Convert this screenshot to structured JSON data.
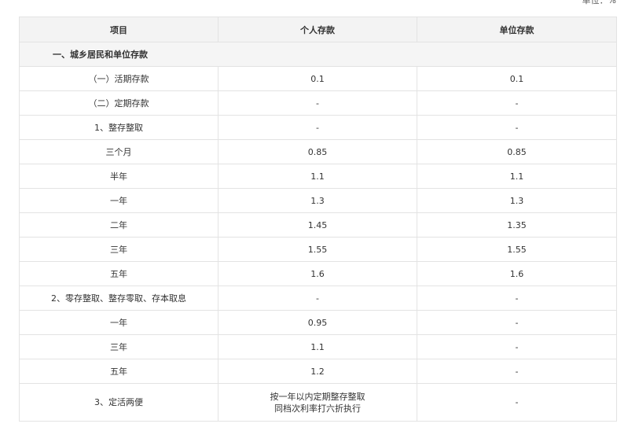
{
  "unit_note": "单位：%",
  "headers": [
    "项目",
    "个人存款",
    "单位存款"
  ],
  "section_title": "一、城乡居民和单位存款",
  "rows": [
    {
      "item": "（一）活期存款",
      "personal": "0.1",
      "unit": "0.1"
    },
    {
      "item": "（二）定期存款",
      "personal": "-",
      "unit": "-"
    },
    {
      "item": "1、整存整取",
      "personal": "-",
      "unit": "-"
    },
    {
      "item": "三个月",
      "personal": "0.85",
      "unit": "0.85"
    },
    {
      "item": "半年",
      "personal": "1.1",
      "unit": "1.1"
    },
    {
      "item": "一年",
      "personal": "1.3",
      "unit": "1.3"
    },
    {
      "item": "二年",
      "personal": "1.45",
      "unit": "1.35"
    },
    {
      "item": "三年",
      "personal": "1.55",
      "unit": "1.55"
    },
    {
      "item": "五年",
      "personal": "1.6",
      "unit": "1.6"
    },
    {
      "item": "2、零存整取、整存零取、存本取息",
      "personal": "-",
      "unit": "-"
    },
    {
      "item": "一年",
      "personal": "0.95",
      "unit": "-"
    },
    {
      "item": "三年",
      "personal": "1.1",
      "unit": "-"
    },
    {
      "item": "五年",
      "personal": "1.2",
      "unit": "-"
    }
  ],
  "last_row": {
    "item": "3、定活两便",
    "personal_line1": "按一年以内定期整存整取",
    "personal_line2": "同档次利率打六折执行",
    "unit": "-"
  }
}
